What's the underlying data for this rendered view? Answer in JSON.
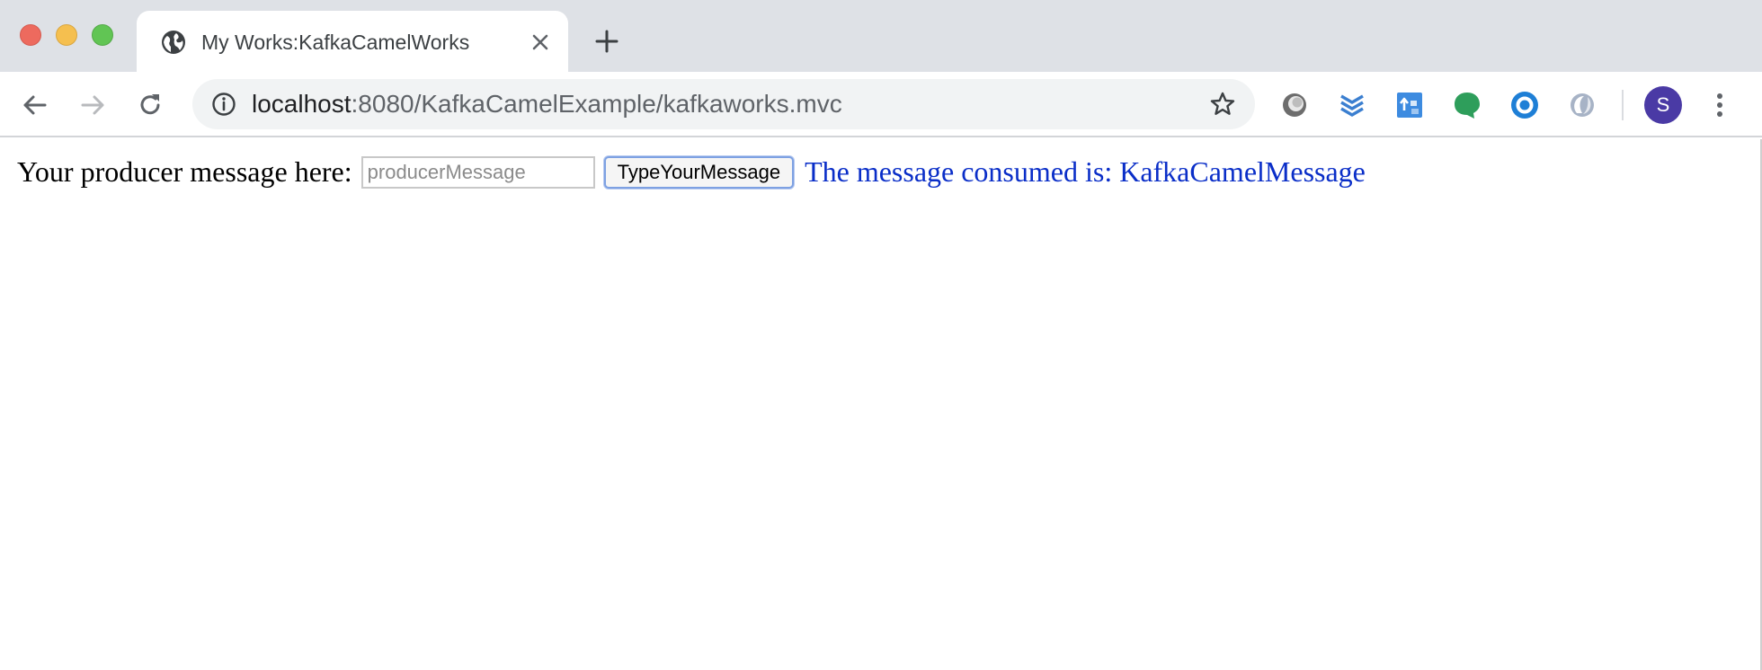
{
  "tab": {
    "title": "My Works:KafkaCamelWorks",
    "favicon": "globe-icon"
  },
  "toolbar": {
    "url_host": "localhost",
    "url_path": ":8080/KafkaCamelExample/kafkaworks.mvc",
    "avatar_letter": "S"
  },
  "page": {
    "producer_label": "Your producer message here:",
    "input_placeholder": "producerMessage",
    "input_value": "",
    "button_label": "TypeYourMessage",
    "consumed_text": "The message consumed is: KafkaCamelMessage"
  },
  "colors": {
    "consumed_text": "#0a2ec8",
    "avatar": "#4a3aa5"
  }
}
